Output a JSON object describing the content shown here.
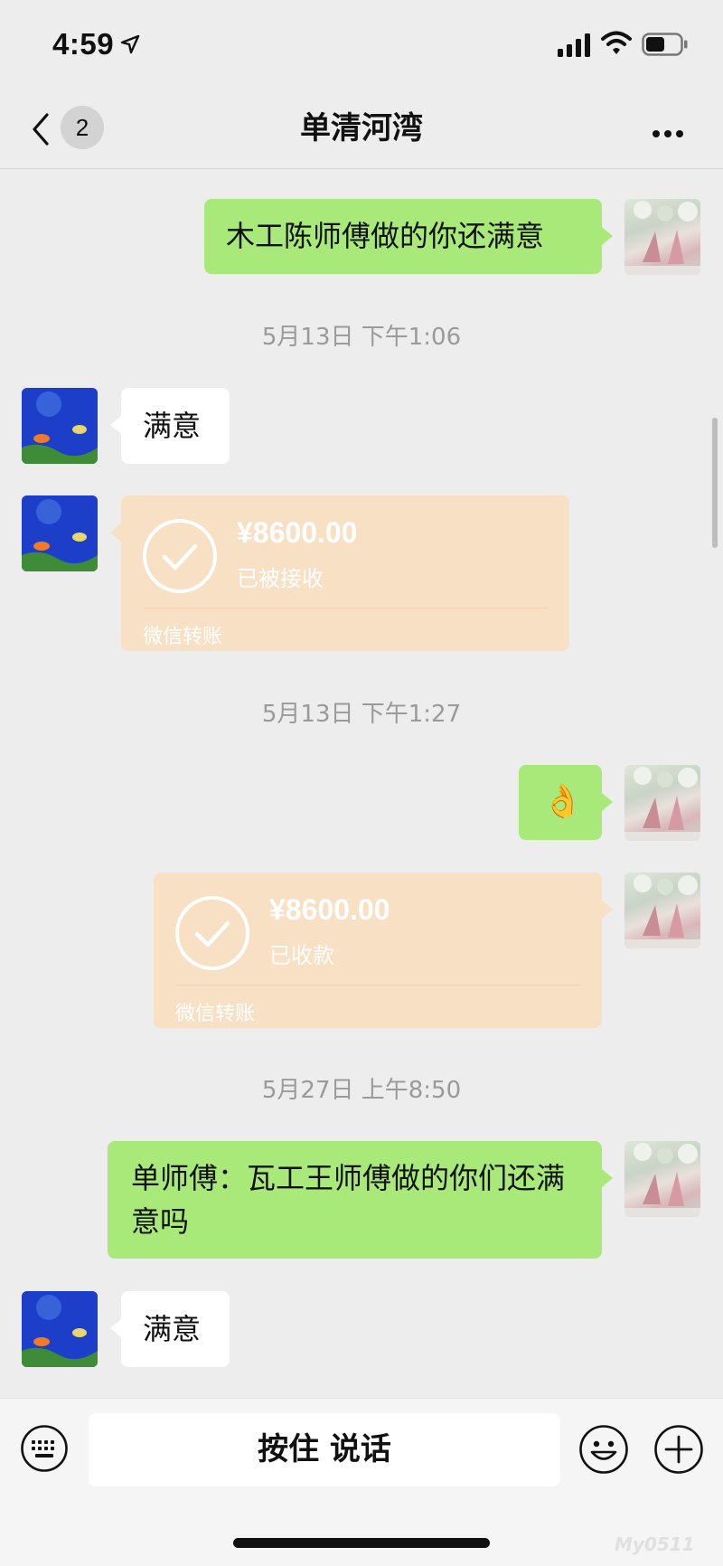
{
  "status_bar": {
    "time": "4:59"
  },
  "header": {
    "back_badge": "2",
    "title": "单清河湾"
  },
  "messages": {
    "m1": {
      "text": "木工陈师傅做的你还满意"
    },
    "ts1": {
      "text": "5月13日 下午1:06"
    },
    "m2": {
      "text": "满意"
    },
    "transfer1": {
      "amount": "¥8600.00",
      "status": "已被接收",
      "footer": "微信转账"
    },
    "ts2": {
      "text": "5月13日 下午1:27"
    },
    "m3": {
      "emoji": "👌"
    },
    "transfer2": {
      "amount": "¥8600.00",
      "status": "已收款",
      "footer": "微信转账"
    },
    "ts3": {
      "text": "5月27日 上午8:50"
    },
    "m4": {
      "text": "单师傅：瓦工王师傅做的你们还满意吗"
    },
    "m5": {
      "text": "满意"
    }
  },
  "input_bar": {
    "hold_to_talk": "按住 说话"
  },
  "watermark": "My0511",
  "colors": {
    "green_bubble": "#a9e97a",
    "transfer_card": "#f7e0c4",
    "background": "#ededed"
  },
  "icons": [
    "location-arrow-icon",
    "signal-icon",
    "wifi-icon",
    "battery-icon",
    "back-chevron-icon",
    "more-icon",
    "checkmark-circle-icon",
    "keyboard-icon",
    "emoji-icon",
    "plus-icon"
  ]
}
